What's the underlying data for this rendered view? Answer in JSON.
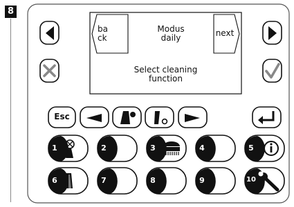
{
  "step": {
    "number": "8"
  },
  "display": {
    "left_softkey": [
      "ba",
      "ck"
    ],
    "right_softkey": "next",
    "mode_title": "Modus",
    "mode_value": "daily",
    "message_line1": "Select cleaning",
    "message_line2": "function"
  },
  "keys": {
    "escape_label": "Esc"
  },
  "function_buttons": [
    {
      "number": "1",
      "icon": "fan-icon"
    },
    {
      "number": "2",
      "icon": ""
    },
    {
      "number": "3",
      "icon": "brush-icon"
    },
    {
      "number": "4",
      "icon": ""
    },
    {
      "number": "5",
      "icon": "info-icon"
    },
    {
      "number": "6",
      "icon": "squeegee-icon"
    },
    {
      "number": "7",
      "icon": ""
    },
    {
      "number": "8",
      "icon": ""
    },
    {
      "number": "9",
      "icon": ""
    },
    {
      "number": "10",
      "icon": "wrench-icon"
    }
  ],
  "colors": {
    "ink": "#111111",
    "frame": "#555555",
    "background": "#ffffff"
  }
}
